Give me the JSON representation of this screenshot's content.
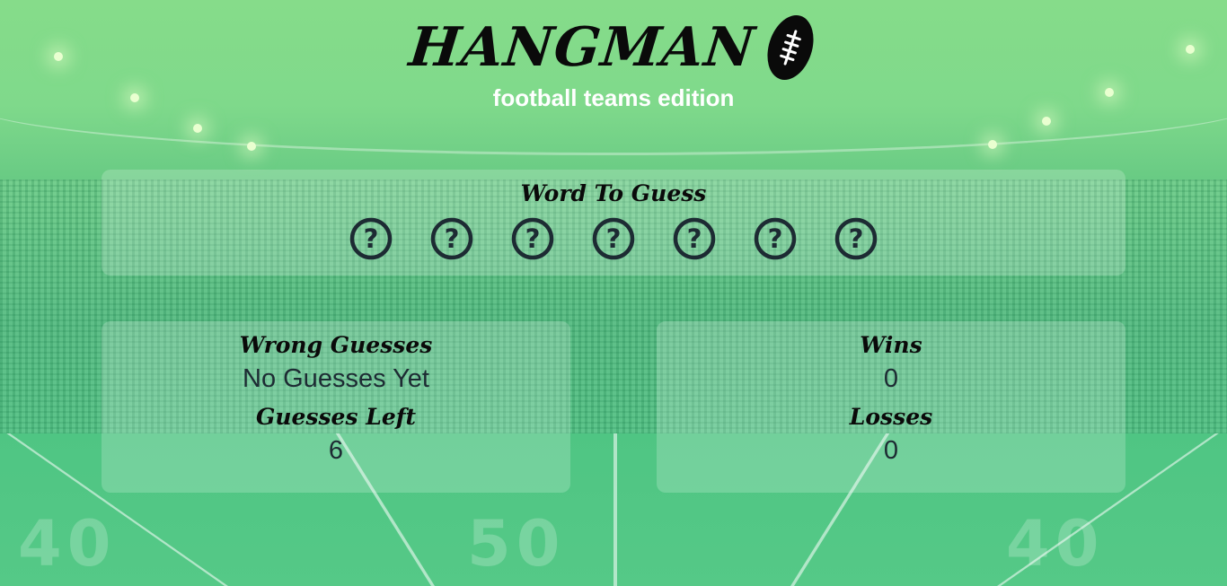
{
  "header": {
    "title": "HANGMAN",
    "subtitle": "football teams edition",
    "logo_icon": "football-icon"
  },
  "word_panel": {
    "heading": "Word To Guess",
    "slots": [
      "?",
      "?",
      "?",
      "?",
      "?",
      "?",
      "?"
    ],
    "slot_icon": "question-circle-icon"
  },
  "guesses_panel": {
    "wrong_heading": "Wrong Guesses",
    "wrong_value": "No Guesses Yet",
    "left_heading": "Guesses Left",
    "left_value": "6"
  },
  "score_panel": {
    "wins_heading": "Wins",
    "wins_value": "0",
    "losses_heading": "Losses",
    "losses_value": "0"
  },
  "background": {
    "yard_numbers": [
      "40",
      "50",
      "40"
    ]
  },
  "colors": {
    "text_dark": "#0a0a0a",
    "value_text": "#1d2b33",
    "panel_bg": "rgba(255,255,255,0.2)",
    "background_green": "#66c983"
  }
}
